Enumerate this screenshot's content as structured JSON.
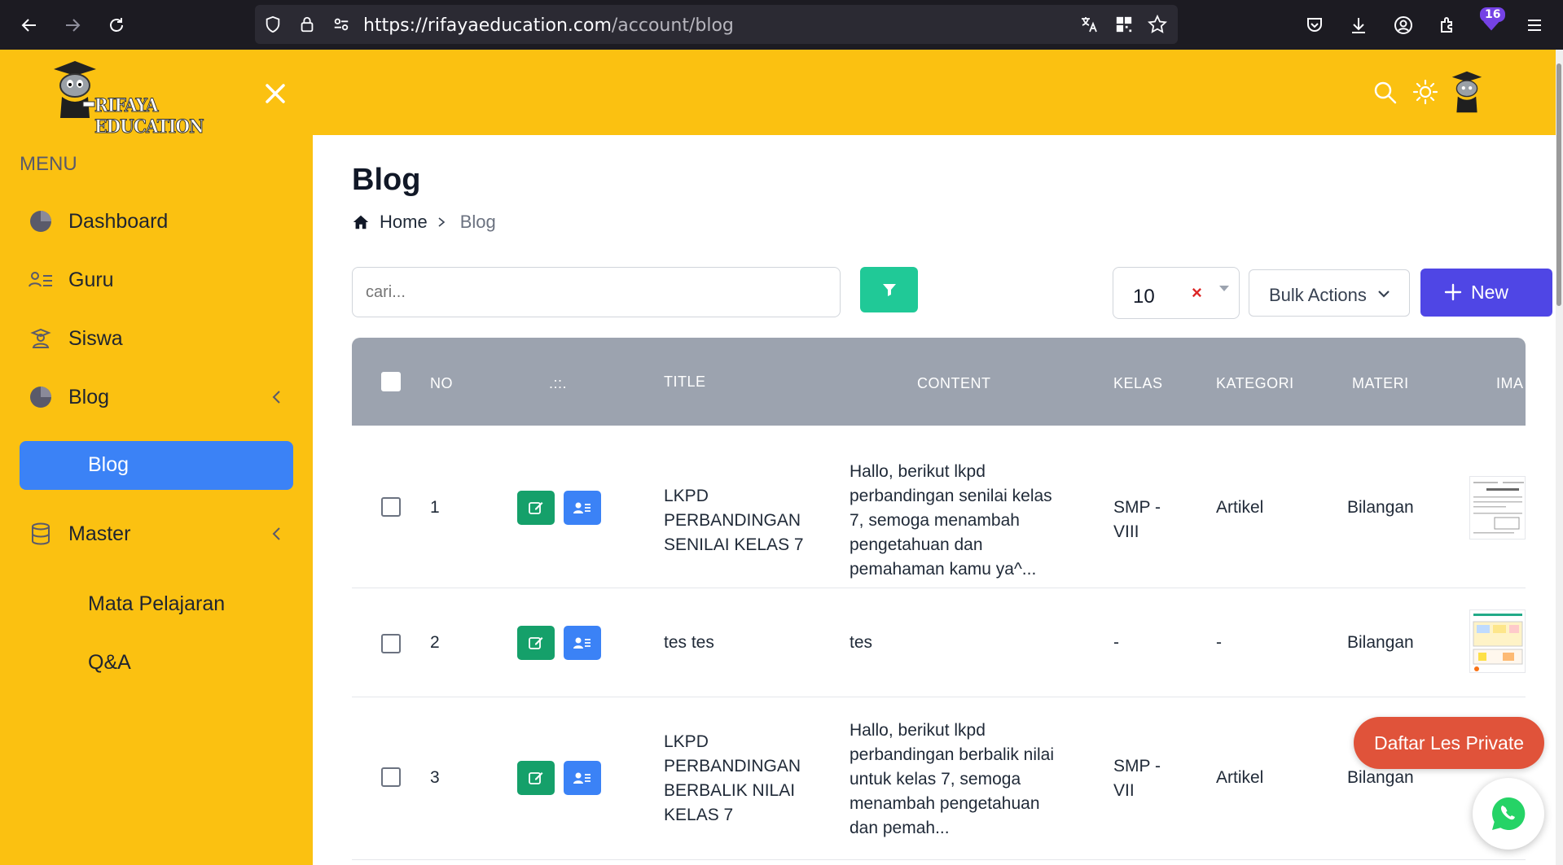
{
  "browser": {
    "url_host": "https://rifayaeducation.com",
    "url_path": "/account/blog",
    "extensions_badge": "16"
  },
  "header": {
    "logo_text": "RIFAYA EDUCATION"
  },
  "sidebar": {
    "menu_title": "MENU",
    "items": [
      {
        "label": "Dashboard",
        "icon": "pie-chart-icon"
      },
      {
        "label": "Guru",
        "icon": "users-list-icon"
      },
      {
        "label": "Siswa",
        "icon": "student-icon"
      },
      {
        "label": "Blog",
        "icon": "pie-chart-icon"
      },
      {
        "label": "Blog"
      },
      {
        "label": "Master",
        "icon": "database-icon"
      },
      {
        "label": "Mata Pelajaran"
      },
      {
        "label": "Q&A"
      }
    ]
  },
  "main": {
    "title": "Blog",
    "breadcrumb": {
      "home": "Home",
      "current": "Blog"
    },
    "search": {
      "placeholder": "cari..."
    },
    "per_page": "10",
    "per_page_clear": "×",
    "bulk_actions": "Bulk Actions",
    "new_button": "New"
  },
  "table": {
    "columns": [
      "NO",
      ".::.",
      "TITLE",
      "CONTENT",
      "KELAS",
      "KATEGORI",
      "MATERI",
      "IMA"
    ],
    "rows": [
      {
        "no": "1",
        "title": "LKPD PERBANDINGAN SENILAI KELAS 7",
        "content": "Hallo, berikut lkpd perbandingan senilai kelas 7, semoga menambah pengetahuan dan pemahaman kamu ya^...",
        "kelas": "SMP - VIII",
        "kategori": "Artikel",
        "materi": "Bilangan"
      },
      {
        "no": "2",
        "title": "tes tes",
        "content": "tes",
        "kelas": "-",
        "kategori": "-",
        "materi": "Bilangan"
      },
      {
        "no": "3",
        "title": "LKPD PERBANDINGAN BERBALIK NILAI KELAS 7",
        "content": "Hallo, berikut lkpd perbandingan berbalik nilai untuk kelas 7, semoga menambah pengetahuan dan pemah...",
        "kelas": "SMP - VII",
        "kategori": "Artikel",
        "materi": "Bilangan"
      }
    ]
  },
  "floating": {
    "daftar_label": "Daftar Les Private"
  },
  "colors": {
    "brand_yellow": "#fbc111",
    "active_blue": "#3b82f6",
    "new_button": "#4f46e5",
    "filter_button": "#20c997",
    "daftar_button": "#e0533a"
  }
}
